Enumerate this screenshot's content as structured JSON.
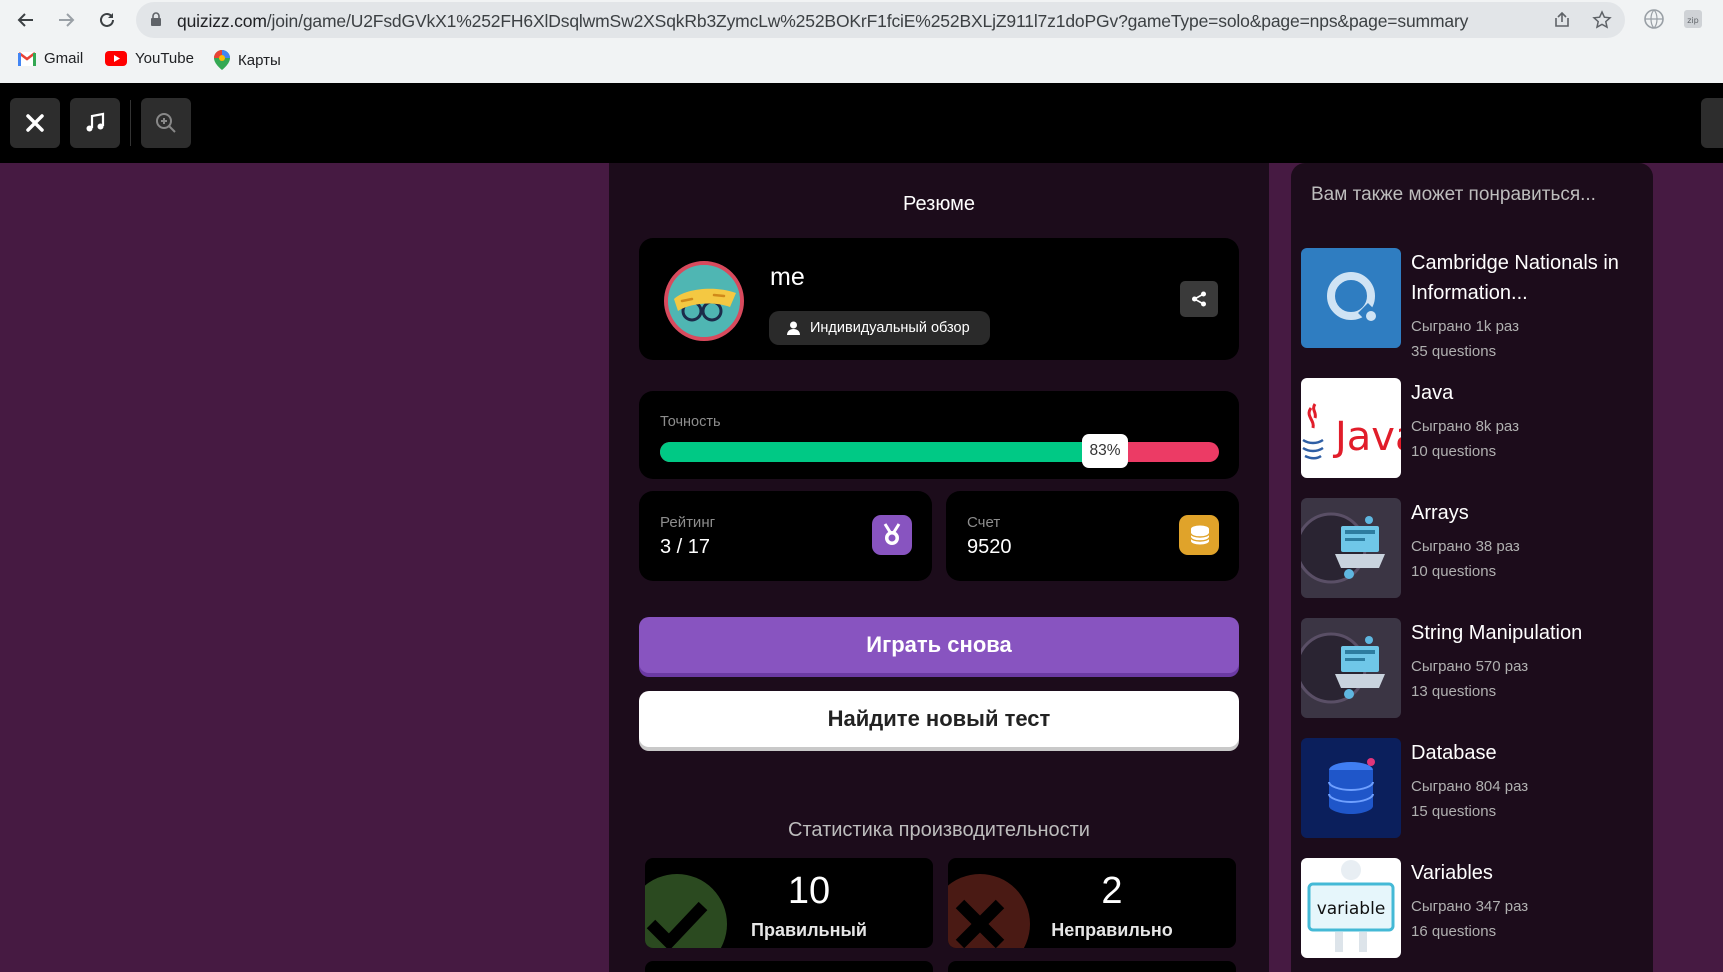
{
  "browser": {
    "url_host": "quizizz.com",
    "url_path": "/join/game/U2FsdGVkX1%252FH6XlDsqlwmSw2XSqkRb3ZymcLw%252BOKrF1fciE%252BXLjZ911l7z1doPGv?gameType=solo&page=nps&page=summary",
    "bookmarks": [
      "Gmail",
      "YouTube",
      "Карты"
    ]
  },
  "summary": {
    "heading": "Резюме",
    "player_name": "me",
    "review_pill": "Индивидуальный обзор",
    "accuracy_label": "Точность",
    "accuracy_value": 0.83,
    "accuracy_text": "83%",
    "rank_label": "Рейтинг",
    "rank_value": "3 / 17",
    "score_label": "Счет",
    "score_value": "9520",
    "play_again": "Играть снова",
    "find_new": "Найдите новый тест",
    "perf_title": "Статистика производительности",
    "correct_count": "10",
    "correct_label": "Правильный",
    "incorrect_count": "2",
    "incorrect_label": "Неправильно"
  },
  "sidebar": {
    "title": "Вам также может понравиться...",
    "items": [
      {
        "title": "Cambridge Nationals in Information...",
        "played": "Сыграно 1k раз",
        "questions": "35 questions",
        "thumb": "quizizz-logo-icon"
      },
      {
        "title": "Java",
        "played": "Сыграно 8k раз",
        "questions": "10 questions",
        "thumb": "java-logo-icon"
      },
      {
        "title": "Arrays",
        "played": "Сыграно 38 раз",
        "questions": "10 questions",
        "thumb": "laptop-illustration"
      },
      {
        "title": "String Manipulation",
        "played": "Сыграно 570 раз",
        "questions": "13 questions",
        "thumb": "laptop-illustration"
      },
      {
        "title": "Database",
        "played": "Сыграно 804 раз",
        "questions": "15 questions",
        "thumb": "database-icon"
      },
      {
        "title": "Variables",
        "played": "Сыграно 347 раз",
        "questions": "16 questions",
        "thumb": "variable-sign"
      }
    ]
  },
  "colors": {
    "background": "#461a42",
    "panel": "#1c0c1b",
    "accent_purple": "#8854c0",
    "correct_green": "#00c985",
    "incorrect_red": "#ec3b65"
  }
}
